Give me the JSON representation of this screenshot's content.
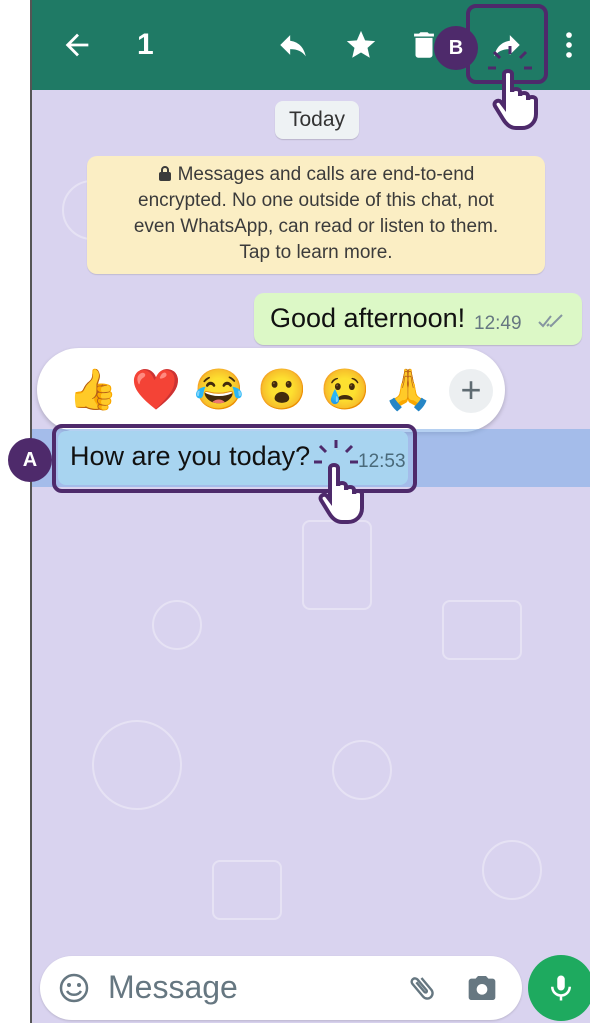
{
  "toolbar": {
    "back_icon": "arrow-left-icon",
    "selected_count": "1",
    "reply_icon": "reply-icon",
    "star_icon": "star-icon",
    "delete_icon": "trash-icon",
    "forward_icon": "forward-icon",
    "menu_icon": "more-vert-icon"
  },
  "chat": {
    "date_chip": "Today",
    "encryption_notice": {
      "lock_icon": "lock-icon",
      "lines": [
        "Messages and calls are end-to-end",
        "encrypted. No one outside of this chat, not",
        "even WhatsApp, can read or listen to them.",
        "Tap to learn more."
      ]
    },
    "outgoing": {
      "text": "Good afternoon!",
      "time": "12:49",
      "status_icon": "double-check-icon"
    },
    "reactions": {
      "emojis": [
        "👍",
        "❤️",
        "😂",
        "😮",
        "😢",
        "🙏"
      ],
      "add_label": "+"
    },
    "incoming_selected": {
      "text": "How are you today?",
      "time": "12:53"
    }
  },
  "annotations": {
    "a_label": "A",
    "b_label": "B"
  },
  "composer": {
    "placeholder": "Message",
    "emoji_icon": "emoji-icon",
    "attach_icon": "paperclip-icon",
    "camera_icon": "camera-icon",
    "mic_icon": "mic-icon"
  },
  "colors": {
    "header": "#1f7a65",
    "wallpaper": "#d9d3ef",
    "outgoing_bubble": "#dcf8c6",
    "selected_bubble": "#a8d4f0",
    "annotation": "#4e2a6b",
    "mic_button": "#1eaa5f"
  }
}
